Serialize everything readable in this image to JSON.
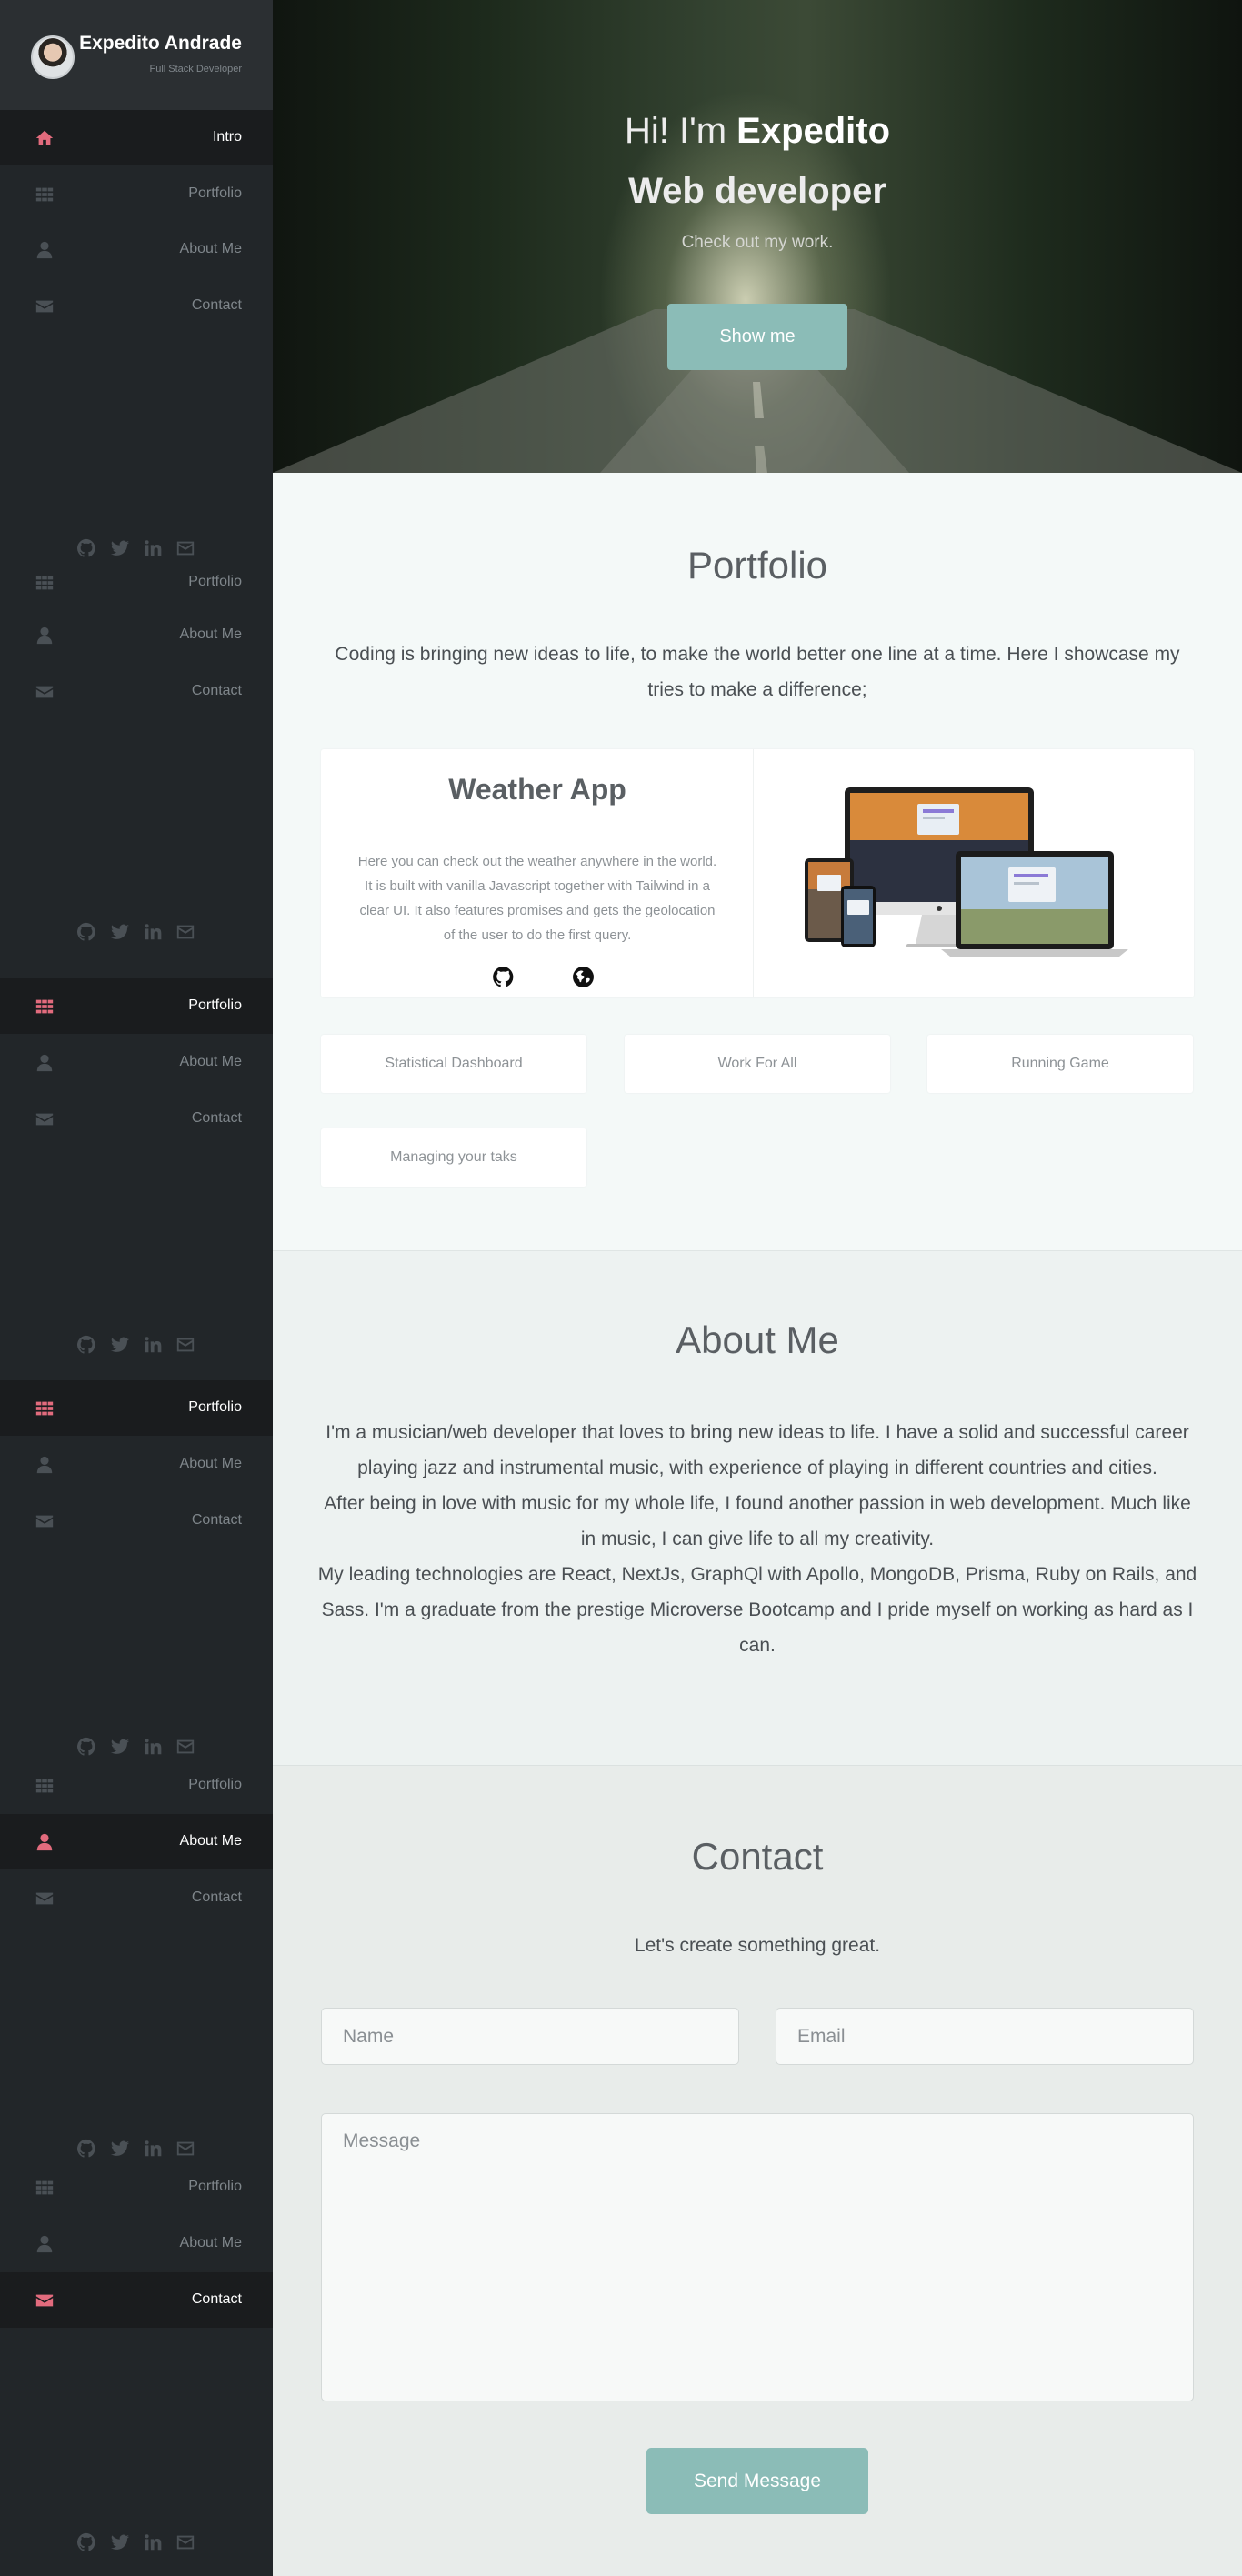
{
  "sidebar": {
    "name": "Expedito Andrade",
    "role": "Full Stack Developer",
    "nav": {
      "intro": "Intro",
      "portfolio": "Portfolio",
      "about": "About Me",
      "contact": "Contact"
    },
    "social_icons": [
      "github-icon",
      "twitter-icon",
      "linkedin-icon",
      "envelope-icon"
    ],
    "accent_color": "#e26b7d"
  },
  "hero": {
    "greeting": "Hi! I'm ",
    "name": "Expedito",
    "subtitle": "Web developer",
    "tagline": "Check out my work.",
    "button": "Show me"
  },
  "portfolio": {
    "title": "Portfolio",
    "intro": "Coding is bringing new ideas to life, to make the world better one line at a time. Here I showcase my tries to make a difference;",
    "featured": {
      "title": "Weather App",
      "description": "Here you can check out the weather anywhere in the world. It is built with vanilla Javascript together with Tailwind in a clear UI. It also features promises and gets the geolocation of the user to do the first query.",
      "links": [
        "github-icon",
        "globe-icon"
      ]
    },
    "projects": [
      "Statistical Dashboard",
      "Work For All",
      "Running Game",
      "Managing your taks"
    ]
  },
  "about": {
    "title": "About Me",
    "paragraphs": [
      "I'm a musician/web developer that loves to bring new ideas to life. I have a solid and successful career playing jazz and instrumental music, with experience of playing in different countries and cities.",
      "After being in love with music for my whole life, I found another passion in web development. Much like in music, I can give life to all my creativity.",
      "My leading technologies are React, NextJs, GraphQl with Apollo, MongoDB, Prisma, Ruby on Rails, and Sass. I'm a graduate from the prestige Microverse Bootcamp and I pride myself on working as hard as I can."
    ]
  },
  "contact": {
    "title": "Contact",
    "subtitle": "Let's create something great.",
    "name_placeholder": "Name",
    "email_placeholder": "Email",
    "message_placeholder": "Message",
    "send": "Send Message"
  },
  "colors": {
    "button_teal": "#8bbcb7",
    "sidebar_bg": "#222629"
  }
}
